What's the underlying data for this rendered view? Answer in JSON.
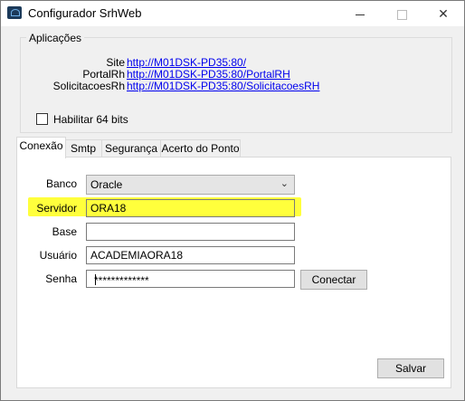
{
  "window": {
    "title": "Configurador SrhWeb",
    "minimize_icon": "minimize-icon",
    "maximize_icon": "maximize-icon",
    "close_symbol": "✕"
  },
  "aplicacoes": {
    "legend": "Aplicações",
    "items": [
      {
        "label": "Site",
        "url": "http://M01DSK-PD35:80/"
      },
      {
        "label": "PortalRh",
        "url": "http://M01DSK-PD35:80/PortalRH"
      },
      {
        "label": "SolicitacoesRh",
        "url": "http://M01DSK-PD35:80/SolicitacoesRH"
      }
    ],
    "checkbox_label": "Habilitar 64 bits",
    "checkbox_checked": false
  },
  "tabs": [
    {
      "label": "Conexão",
      "active": true
    },
    {
      "label": "Smtp",
      "active": false
    },
    {
      "label": "Segurança",
      "active": false
    },
    {
      "label": "Acerto do Ponto",
      "active": false
    }
  ],
  "conexao": {
    "banco_label": "Banco",
    "banco_value": "Oracle",
    "servidor_label": "Servidor",
    "servidor_value": "ORA18",
    "base_label": "Base",
    "base_value": "",
    "usuario_label": "Usuário",
    "usuario_value": "ACADEMIAORA18",
    "senha_label": "Senha",
    "senha_value": "*************",
    "conectar_label": "Conectar",
    "salvar_label": "Salvar"
  },
  "colors": {
    "highlight": "#ffff3c",
    "link": "#0000ee"
  }
}
